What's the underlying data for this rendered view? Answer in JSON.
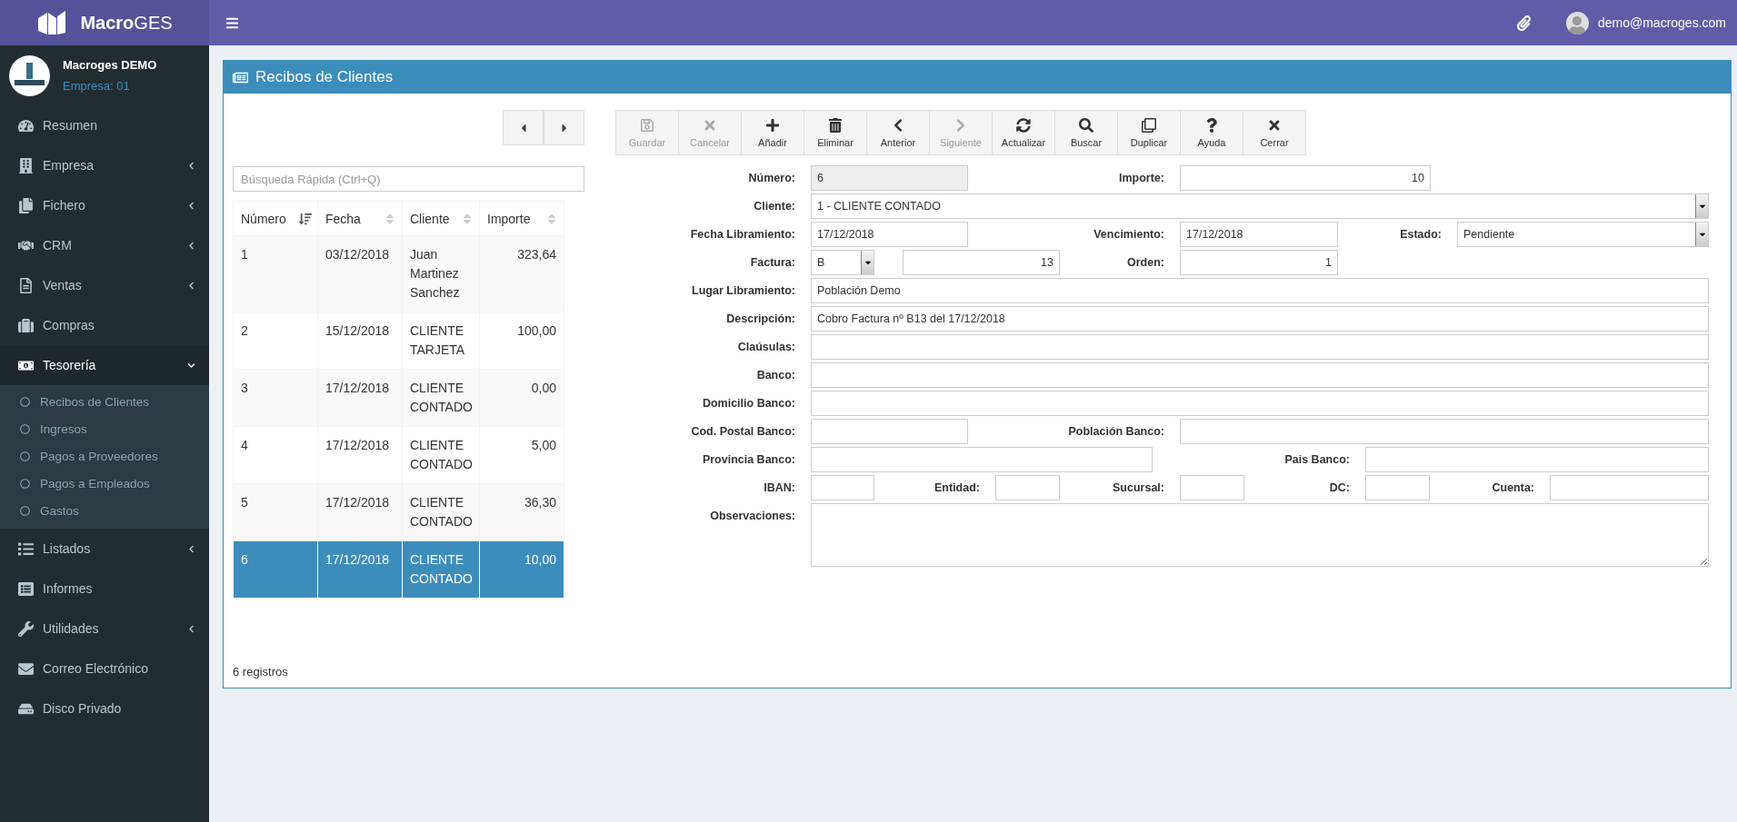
{
  "topbar": {
    "brand": "**Macro**GES",
    "user": "demo@macroges.com"
  },
  "sidebar": {
    "user_name": "Macroges DEMO",
    "company": "Empresa: 01",
    "items": [
      {
        "label": "Resumen",
        "kind": "link",
        "expanded": false
      },
      {
        "label": "Empresa",
        "kind": "menu",
        "expanded": false
      },
      {
        "label": "Fichero",
        "kind": "menu",
        "expanded": false
      },
      {
        "label": "CRM",
        "kind": "menu",
        "expanded": false
      },
      {
        "label": "Ventas",
        "kind": "menu",
        "expanded": false
      },
      {
        "label": "Compras",
        "kind": "link",
        "expanded": false
      },
      {
        "label": "Tesorería",
        "kind": "menu",
        "expanded": true,
        "children": [
          {
            "label": "Recibos de Clientes"
          },
          {
            "label": "Ingresos"
          },
          {
            "label": "Pagos a Proveedores"
          },
          {
            "label": "Pagos a Empleados"
          },
          {
            "label": "Gastos"
          }
        ]
      },
      {
        "label": "Listados",
        "kind": "menu",
        "expanded": false
      },
      {
        "label": "Informes",
        "kind": "link",
        "expanded": false
      },
      {
        "label": "Utilidades",
        "kind": "menu",
        "expanded": false
      },
      {
        "label": "Correo Electrónico",
        "kind": "link",
        "expanded": false
      },
      {
        "label": "Disco Privado",
        "kind": "link",
        "expanded": false
      }
    ]
  },
  "panel": {
    "title": "Recibos de Clientes"
  },
  "toolbar": [
    {
      "label": "Guardar",
      "disabled": true
    },
    {
      "label": "Cancelar",
      "disabled": true
    },
    {
      "label": "Añadir",
      "disabled": false
    },
    {
      "label": "Eliminar",
      "disabled": false
    },
    {
      "label": "Anterior",
      "disabled": false
    },
    {
      "label": "Siguiente",
      "disabled": true
    },
    {
      "label": "Actualizar",
      "disabled": false
    },
    {
      "label": "Buscar",
      "disabled": false
    },
    {
      "label": "Duplicar",
      "disabled": false
    },
    {
      "label": "Ayuda",
      "disabled": false
    },
    {
      "label": "Cerrar",
      "disabled": false
    }
  ],
  "search": {
    "placeholder": "Búsqueda Rápida (Ctrl+Q)"
  },
  "table": {
    "columns": [
      {
        "label": "Número",
        "sorted": true
      },
      {
        "label": "Fecha",
        "sorted": false
      },
      {
        "label": "Cliente",
        "sorted": false
      },
      {
        "label": "Importe",
        "sorted": false
      }
    ],
    "rows": [
      {
        "cells": [
          "1",
          "03/12/2018",
          "Juan Martinez Sanchez",
          "323,64"
        ],
        "selected": false
      },
      {
        "cells": [
          "2",
          "15/12/2018",
          "CLIENTE TARJETA",
          "100,00"
        ],
        "selected": false
      },
      {
        "cells": [
          "3",
          "17/12/2018",
          "CLIENTE CONTADO",
          "0,00"
        ],
        "selected": false
      },
      {
        "cells": [
          "4",
          "17/12/2018",
          "CLIENTE CONTADO",
          "5,00"
        ],
        "selected": false
      },
      {
        "cells": [
          "5",
          "17/12/2018",
          "CLIENTE CONTADO",
          "36,30"
        ],
        "selected": false
      },
      {
        "cells": [
          "6",
          "17/12/2018",
          "CLIENTE CONTADO",
          "10,00"
        ],
        "selected": true
      }
    ]
  },
  "status": "6 registros",
  "form": [
    [
      {
        "label": "Número:",
        "value": "6",
        "kind": "readonly"
      },
      {
        "label": "Importe:",
        "value": "10",
        "kind": "number"
      }
    ],
    [
      {
        "label": "Cliente:",
        "value": "1 - CLIENTE CONTADO",
        "kind": "select"
      }
    ],
    [
      {
        "label": "Fecha Libramiento:",
        "value": "17/12/2018",
        "kind": "text"
      },
      {
        "label": "Vencimiento:",
        "value": "17/12/2018",
        "kind": "text"
      },
      {
        "label": "Estado:",
        "value": "Pendiente",
        "kind": "select"
      }
    ],
    [
      {
        "label": "Factura:",
        "value": "B",
        "kind": "select"
      },
      {
        "value": "13",
        "kind": "number"
      },
      {
        "label": "Orden:",
        "value": "1",
        "kind": "number"
      }
    ],
    [
      {
        "label": "Lugar Libramiento:",
        "value": "Población Demo",
        "kind": "text"
      }
    ],
    [
      {
        "label": "Descripción:",
        "value": "Cobro Factura nº B13 del 17/12/2018",
        "kind": "text"
      }
    ],
    [
      {
        "label": "Claúsulas:",
        "kind": "text"
      }
    ],
    [
      {
        "label": "Banco:",
        "kind": "text"
      }
    ],
    [
      {
        "label": "Domicilio Banco:",
        "kind": "text"
      }
    ],
    [
      {
        "label": "Cod. Postal Banco:",
        "kind": "text"
      },
      {
        "label": "Población Banco:",
        "kind": "text"
      }
    ],
    [
      {
        "label": "Provincia Banco:",
        "kind": "text"
      },
      {
        "label": "Pais Banco:",
        "kind": "text"
      }
    ],
    [
      {
        "label": "IBAN:",
        "kind": "text"
      },
      {
        "label": "Entidad:",
        "kind": "text"
      },
      {
        "label": "Sucursal:",
        "kind": "text"
      },
      {
        "label": "DC:",
        "kind": "text"
      },
      {
        "label": "Cuenta:",
        "kind": "text"
      }
    ],
    [
      {
        "label": "Observaciones:",
        "kind": "textarea"
      }
    ]
  ]
}
